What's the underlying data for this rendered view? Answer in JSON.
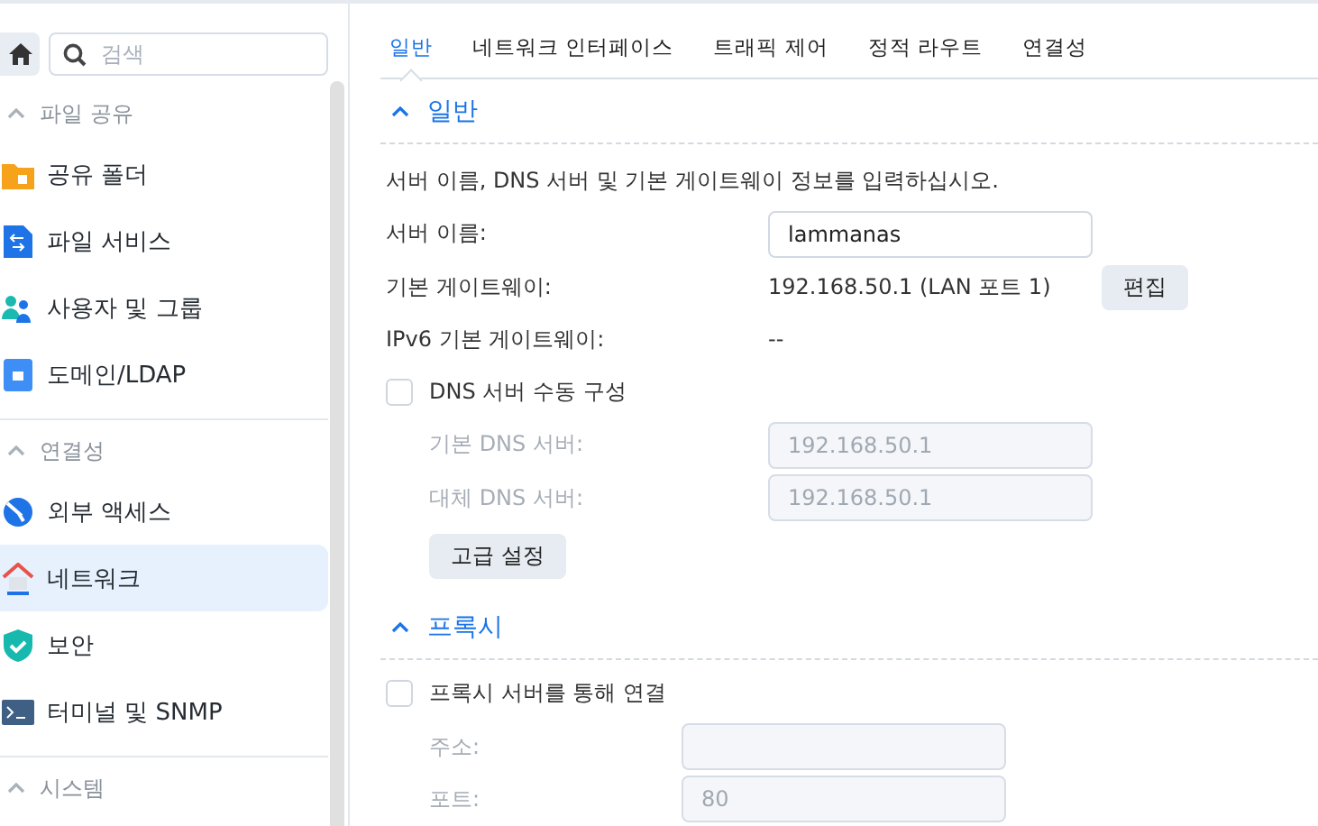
{
  "sidebar": {
    "search": {
      "placeholder": "검색"
    },
    "groups": [
      {
        "title": "파일 공유",
        "expanded": true,
        "items": [
          {
            "label": "공유 폴더",
            "kind": "folder",
            "selected": false
          },
          {
            "label": "파일 서비스",
            "kind": "file",
            "selected": false
          },
          {
            "label": "사용자 및 그룹",
            "kind": "users",
            "selected": false
          },
          {
            "label": "도메인/LDAP",
            "kind": "domain",
            "selected": false
          }
        ]
      },
      {
        "title": "연결성",
        "expanded": true,
        "items": [
          {
            "label": "외부 액세스",
            "kind": "globe",
            "selected": false
          },
          {
            "label": "네트워크",
            "kind": "house",
            "selected": true
          },
          {
            "label": "보안",
            "kind": "shield",
            "selected": false
          },
          {
            "label": "터미널 및 SNMP",
            "kind": "terminal",
            "selected": false
          }
        ]
      },
      {
        "title": "시스템",
        "expanded": true
      }
    ]
  },
  "tabs": [
    {
      "label": "일반",
      "selected": true
    },
    {
      "label": "네트워크 인터페이스",
      "selected": false
    },
    {
      "label": "트래픽 제어",
      "selected": false
    },
    {
      "label": "정적 라우트",
      "selected": false
    },
    {
      "label": "연결성",
      "selected": false
    }
  ],
  "general": {
    "title": "일반",
    "expanded": true,
    "description": "서버 이름, DNS 서버 및 기본 게이트웨이 정보를 입력하십시오.",
    "server_name": {
      "label": "서버 이름:",
      "value": "lammanas"
    },
    "gateway": {
      "label": "기본 게이트웨이:",
      "value": "192.168.50.1 (LAN 포트 1)",
      "button": "편집"
    },
    "ipv6_gateway": {
      "label": "IPv6 기본 게이트웨이:",
      "value": "--"
    },
    "manual_dns": {
      "label": "DNS 서버 수동 구성",
      "checked": false
    },
    "dns_fields": [
      {
        "label": "기본 DNS 서버:",
        "value": "192.168.50.1",
        "disabled": true
      },
      {
        "label": "대체 DNS 서버:",
        "value": "192.168.50.1",
        "disabled": true
      }
    ],
    "advanced_button": "고급 설정"
  },
  "proxy": {
    "title": "프록시",
    "expanded": true,
    "use_proxy": {
      "label": "프록시 서버를 통해 연결",
      "checked": false
    },
    "fields": [
      {
        "label": "주소:",
        "disabled": true
      },
      {
        "label": "포트:",
        "value": "80",
        "disabled": true
      }
    ]
  }
}
